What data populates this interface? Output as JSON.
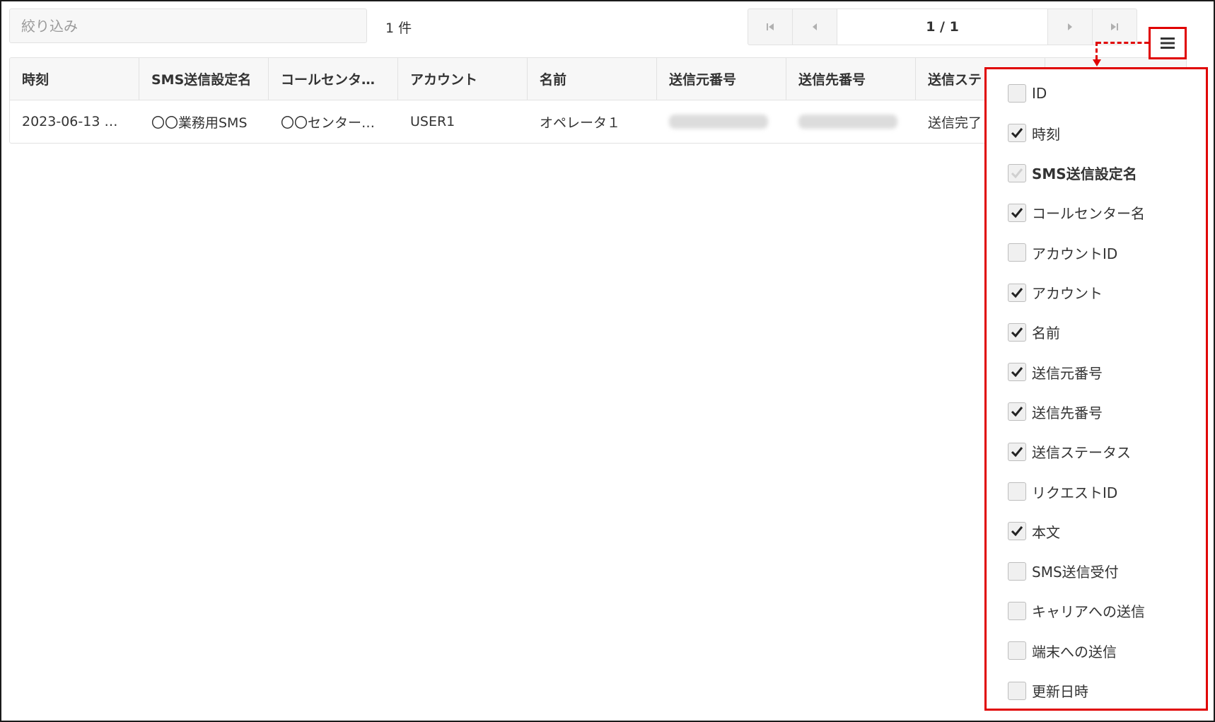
{
  "toolbar": {
    "filter_placeholder": "絞り込み",
    "count": "1 件",
    "page_indicator": "1 / 1"
  },
  "table": {
    "columns": [
      "時刻",
      "SMS送信設定名",
      "コールセンタ…",
      "アカウント",
      "名前",
      "送信元番号",
      "送信先番号",
      "送信ステ"
    ],
    "rows": [
      {
        "time": "2023-06-13 …",
        "sms_setting": "〇〇業務用SMS",
        "call_center": "〇〇センター…",
        "account": "USER1",
        "name": "オペレータ１",
        "from_number": "",
        "to_number": "",
        "status": "送信完了"
      }
    ]
  },
  "column_chooser": {
    "options": [
      {
        "label": "ID",
        "checked": false
      },
      {
        "label": "時刻",
        "checked": true
      },
      {
        "label": "SMS送信設定名",
        "checked": true,
        "disabled": true
      },
      {
        "label": "コールセンター名",
        "checked": true
      },
      {
        "label": "アカウントID",
        "checked": false
      },
      {
        "label": "アカウント",
        "checked": true
      },
      {
        "label": "名前",
        "checked": true
      },
      {
        "label": "送信元番号",
        "checked": true
      },
      {
        "label": "送信先番号",
        "checked": true
      },
      {
        "label": "送信ステータス",
        "checked": true
      },
      {
        "label": "リクエストID",
        "checked": false
      },
      {
        "label": "本文",
        "checked": true
      },
      {
        "label": "SMS送信受付",
        "checked": false
      },
      {
        "label": "キャリアへの送信",
        "checked": false
      },
      {
        "label": "端末への送信",
        "checked": false
      },
      {
        "label": "更新日時",
        "checked": false
      }
    ]
  },
  "colors": {
    "highlight": "#e00000",
    "header_bg": "#f7f7f7",
    "border": "#e2e2e2"
  }
}
